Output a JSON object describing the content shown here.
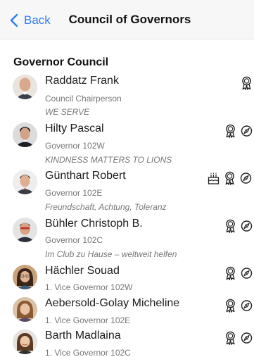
{
  "nav": {
    "back_label": "Back",
    "title": "Council of Governors"
  },
  "section": {
    "title": "Governor Council"
  },
  "members": [
    {
      "name": "Raddatz Frank",
      "role": "Council Chairperson",
      "motto": "WE SERVE",
      "badges": [
        "ribbon-award-icon"
      ]
    },
    {
      "name": "Hilty Pascal",
      "role": "Governor 102W",
      "motto": "KINDNESS MATTERS TO LIONS",
      "badges": [
        "ribbon-award-icon",
        "compass-icon"
      ]
    },
    {
      "name": "Günthart Robert",
      "role": "Governor 102E",
      "motto": "Freundschaft, Achtung, Toleranz",
      "badges": [
        "birthday-cake-icon",
        "ribbon-award-icon",
        "compass-icon"
      ]
    },
    {
      "name": "Bühler Christoph B.",
      "role": "Governor 102C",
      "motto": "Im Club zu Hause – weltweit helfen",
      "badges": [
        "ribbon-award-icon",
        "compass-icon"
      ]
    },
    {
      "name": "Hächler Souad",
      "role": "1. Vice Governor 102W",
      "motto": "",
      "badges": [
        "ribbon-award-icon",
        "compass-icon"
      ]
    },
    {
      "name": "Aebersold-Golay Micheline",
      "role": "1. Vice Governor 102E",
      "motto": "",
      "badges": [
        "ribbon-award-icon",
        "compass-icon"
      ]
    },
    {
      "name": "Barth Madlaina",
      "role": "1. Vice Governor 102C",
      "motto": "",
      "badges": [
        "ribbon-award-icon",
        "compass-icon"
      ]
    }
  ],
  "colors": {
    "accent": "#2f7cf6",
    "secondary_text": "#777777",
    "nav_background": "#f7f7f7"
  }
}
